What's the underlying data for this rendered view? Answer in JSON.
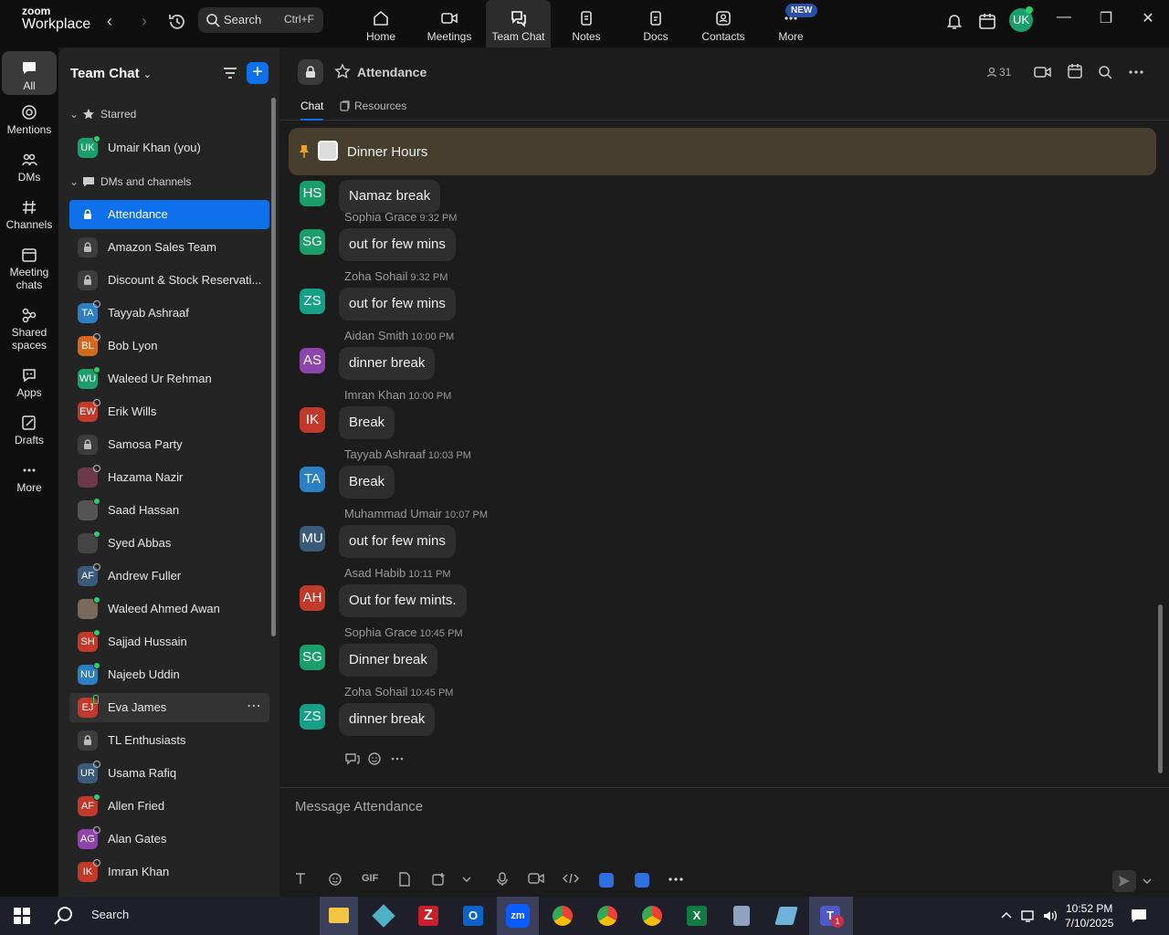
{
  "app": {
    "brand_top": "zoom",
    "brand_bottom": "Workplace"
  },
  "search": {
    "label": "Search",
    "shortcut": "Ctrl+F"
  },
  "nav_tabs": [
    {
      "label": "Home"
    },
    {
      "label": "Meetings"
    },
    {
      "label": "Team Chat"
    },
    {
      "label": "Notes"
    },
    {
      "label": "Docs"
    },
    {
      "label": "Contacts"
    },
    {
      "label": "More"
    }
  ],
  "new_badge": "NEW",
  "user": {
    "initials": "UK",
    "color": "#1a9e6b"
  },
  "rail": [
    {
      "label": "All"
    },
    {
      "label": "Mentions"
    },
    {
      "label": "DMs"
    },
    {
      "label": "Channels"
    },
    {
      "label": "Meeting chats"
    },
    {
      "label": "Shared spaces"
    },
    {
      "label": "Apps"
    },
    {
      "label": "Drafts"
    },
    {
      "label": "More"
    }
  ],
  "sidebar": {
    "title": "Team Chat",
    "starred_header": "Starred",
    "starred": {
      "initials": "UK",
      "label": "Umair Khan (you)",
      "color": "#1a9e6b"
    },
    "dms_header": "DMs and channels",
    "items": [
      {
        "type": "channel",
        "label": "Attendance"
      },
      {
        "type": "channel",
        "label": "Amazon Sales Team"
      },
      {
        "type": "channel",
        "label": "Discount & Stock Reservati..."
      },
      {
        "type": "dm",
        "initials": "TA",
        "label": "Tayyab Ashraaf",
        "color": "#2b7fc2",
        "status": "offline"
      },
      {
        "type": "dm",
        "initials": "BL",
        "label": "Bob Lyon",
        "color": "#d2691e",
        "status": "offline"
      },
      {
        "type": "dm",
        "initials": "WU",
        "label": "Waleed Ur Rehman",
        "color": "#1a9e6b",
        "status": "online"
      },
      {
        "type": "dm",
        "initials": "EW",
        "label": "Erik Wills",
        "color": "#c0392b",
        "status": "offline"
      },
      {
        "type": "channel",
        "label": "Samosa Party"
      },
      {
        "type": "dm",
        "initials": "",
        "label": "Hazama Nazir",
        "color": "#6b3a4a",
        "status": "offline"
      },
      {
        "type": "dm",
        "initials": "",
        "label": "Saad Hassan",
        "color": "#555",
        "status": "online"
      },
      {
        "type": "dm",
        "initials": "",
        "label": "Syed Abbas",
        "color": "#444",
        "status": "online"
      },
      {
        "type": "dm",
        "initials": "AF",
        "label": "Andrew Fuller",
        "color": "#3a5a7a",
        "status": "offline"
      },
      {
        "type": "dm",
        "initials": "",
        "label": "Waleed Ahmed Awan",
        "color": "#7a6a5a",
        "status": "online"
      },
      {
        "type": "dm",
        "initials": "SH",
        "label": "Sajjad Hussain",
        "color": "#c0392b",
        "status": "online"
      },
      {
        "type": "dm",
        "initials": "NU",
        "label": "Najeeb Uddin",
        "color": "#2b7fc2",
        "status": "online"
      },
      {
        "type": "dm",
        "initials": "EJ",
        "label": "Eva James",
        "color": "#c0392b",
        "status": "mobile"
      },
      {
        "type": "channel",
        "label": "TL Enthusiasts"
      },
      {
        "type": "dm",
        "initials": "UR",
        "label": "Usama Rafiq",
        "color": "#3a5a7a",
        "status": "offline"
      },
      {
        "type": "dm",
        "initials": "AF",
        "label": "Allen Fried",
        "color": "#c0392b",
        "status": "online"
      },
      {
        "type": "dm",
        "initials": "AG",
        "label": "Alan Gates",
        "color": "#8e44ad",
        "status": "offline"
      },
      {
        "type": "dm",
        "initials": "IK",
        "label": "Imran Khan",
        "color": "#c0392b",
        "status": "offline"
      }
    ]
  },
  "channel": {
    "title": "Attendance",
    "member_count": "31",
    "tabs": [
      {
        "label": "Chat"
      },
      {
        "label": "Resources"
      }
    ],
    "pinned": "Dinner Hours",
    "messages": [
      {
        "initials": "HS",
        "name": "",
        "time": "",
        "text": "Namaz break",
        "color": "#1a9e6b"
      },
      {
        "initials": "SG",
        "name": "Sophia Grace",
        "time": "9:32 PM",
        "text": "out for few mins",
        "color": "#1a9e6b"
      },
      {
        "initials": "ZS",
        "name": "Zoha Sohail",
        "time": "9:32 PM",
        "text": "out for few mins",
        "color": "#16a085"
      },
      {
        "initials": "AS",
        "name": "Aidan Smith",
        "time": "10:00 PM",
        "text": "dinner break",
        "color": "#8e44ad"
      },
      {
        "initials": "IK",
        "name": "Imran Khan",
        "time": "10:00 PM",
        "text": "Break",
        "color": "#c0392b"
      },
      {
        "initials": "TA",
        "name": "Tayyab Ashraaf",
        "time": "10:03 PM",
        "text": "Break",
        "color": "#2b7fc2"
      },
      {
        "initials": "MU",
        "name": "Muhammad Umair",
        "time": "10:07 PM",
        "text": "out for few mins",
        "color": "#3a5a7a"
      },
      {
        "initials": "AH",
        "name": "Asad Habib",
        "time": "10:11 PM",
        "text": "Out for few mints.",
        "color": "#c0392b"
      },
      {
        "initials": "SG",
        "name": "Sophia Grace",
        "time": "10:45 PM",
        "text": "Dinner break",
        "color": "#1a9e6b"
      },
      {
        "initials": "ZS",
        "name": "Zoha Sohail",
        "time": "10:45 PM",
        "text": "dinner break",
        "color": "#16a085"
      }
    ],
    "composer_placeholder": "Message Attendance",
    "composer_gif": "GIF"
  },
  "taskbar": {
    "search": "Search",
    "time": "10:52 PM",
    "date": "7/10/2025",
    "teams_badge": "1"
  }
}
